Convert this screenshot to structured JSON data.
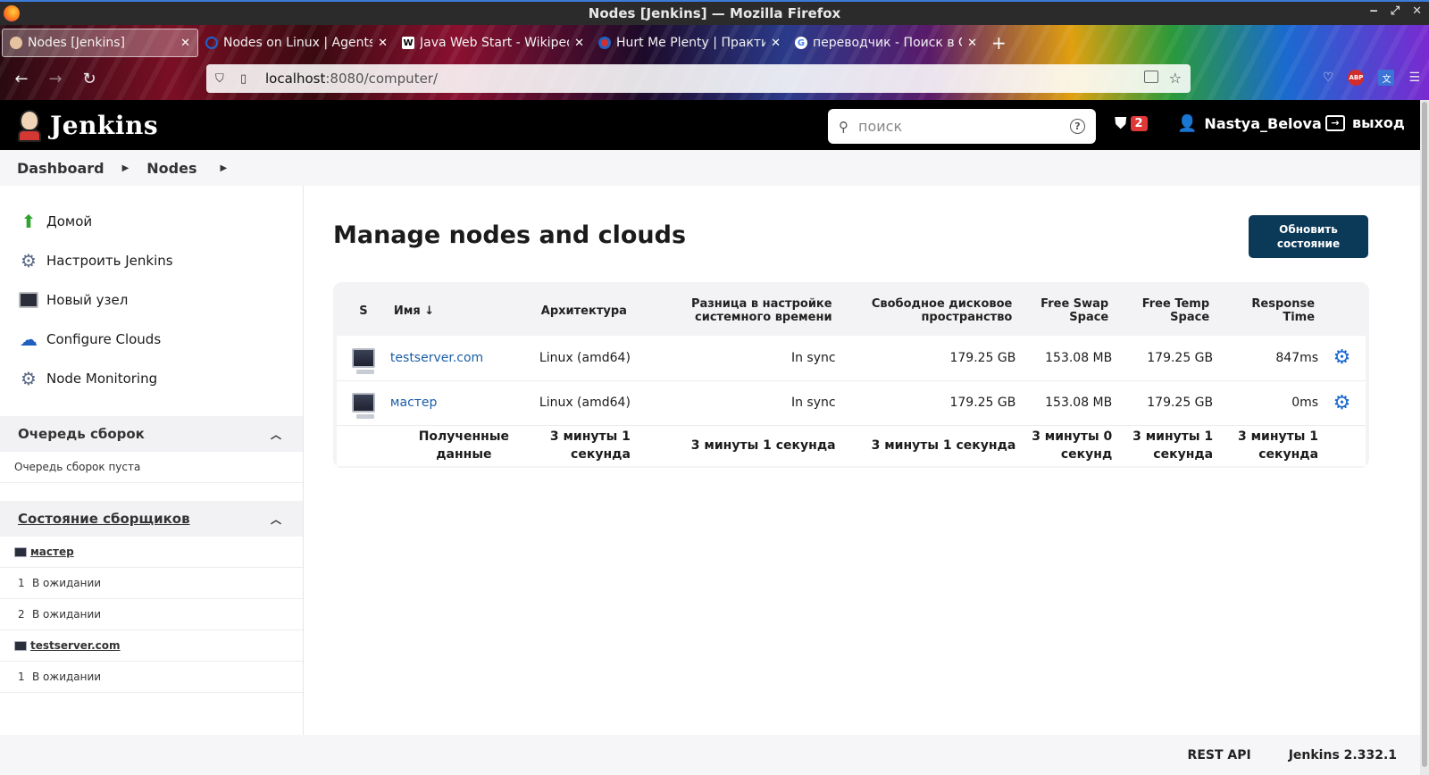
{
  "window": {
    "title": "Nodes [Jenkins] — Mozilla Firefox"
  },
  "tabs": [
    {
      "label": "Nodes [Jenkins]",
      "active": true,
      "favicon": "jenkins-icon"
    },
    {
      "label": "Nodes on Linux | Agents",
      "active": false,
      "favicon": "opera-icon"
    },
    {
      "label": "Java Web Start - Wikiped",
      "active": false,
      "favicon": "wikipedia-icon"
    },
    {
      "label": "Hurt Me Plenty | Практи",
      "active": false,
      "favicon": "epam-icon"
    },
    {
      "label": "переводчик - Поиск в G",
      "active": false,
      "favicon": "google-icon"
    }
  ],
  "url": {
    "host": "localhost",
    "path": ":8080/computer/"
  },
  "header": {
    "brand": "Jenkins",
    "search_placeholder": "поиск",
    "alert_count": "2",
    "user": "Nastya_Belova",
    "logout": "выход"
  },
  "breadcrumb": {
    "items": [
      "Dashboard",
      "Nodes"
    ]
  },
  "sidebar": {
    "tasks": [
      {
        "label": "Домой",
        "icon": "up-arrow-icon"
      },
      {
        "label": "Настроить Jenkins",
        "icon": "gear-icon"
      },
      {
        "label": "Новый узел",
        "icon": "computer-icon"
      },
      {
        "label": "Configure Clouds",
        "icon": "cloud-icon"
      },
      {
        "label": "Node Monitoring",
        "icon": "gear-icon"
      }
    ],
    "build_queue": {
      "title": "Очередь сборок",
      "empty": "Очередь сборок пуста"
    },
    "executors": {
      "title": "Состояние сборщиков",
      "master": {
        "name": "мастер",
        "rows": [
          {
            "num": "1",
            "status": "В ожидании"
          },
          {
            "num": "2",
            "status": "В ожидании"
          }
        ]
      },
      "test": {
        "name": "testserver.com",
        "rows": [
          {
            "num": "1",
            "status": "В ожидании"
          }
        ]
      }
    }
  },
  "main": {
    "title": "Manage nodes and clouds",
    "refresh_label": "Обновить состояние",
    "table": {
      "headers": [
        "S",
        "Имя ↓",
        "Архитектура",
        "Разница в настройке системного времени",
        "Свободное дисковое пространство",
        "Free Swap Space",
        "Free Temp Space",
        "Response Time"
      ],
      "rows": [
        {
          "name": "testserver.com",
          "arch": "Linux (amd64)",
          "clock": "In sync",
          "disk": "179.25 GB",
          "swap": "153.08 MB",
          "temp": "179.25 GB",
          "resp": "847ms"
        },
        {
          "name": "мастер",
          "arch": "Linux (amd64)",
          "clock": "In sync",
          "disk": "179.25 GB",
          "swap": "153.08 MB",
          "temp": "179.25 GB",
          "resp": "0ms"
        }
      ],
      "footer": {
        "label": "Полученные данные",
        "arch": "3 минуты 1 секунда",
        "clock": "3 минуты 1 секунда",
        "disk": "3 минуты 1 секунда",
        "swap": "3 минуты 0 секунд",
        "temp": "3 минуты 1 секунда",
        "resp": "3 минуты 1 секунда"
      }
    }
  },
  "footer": {
    "rest_api": "REST API",
    "version": "Jenkins 2.332.1"
  }
}
